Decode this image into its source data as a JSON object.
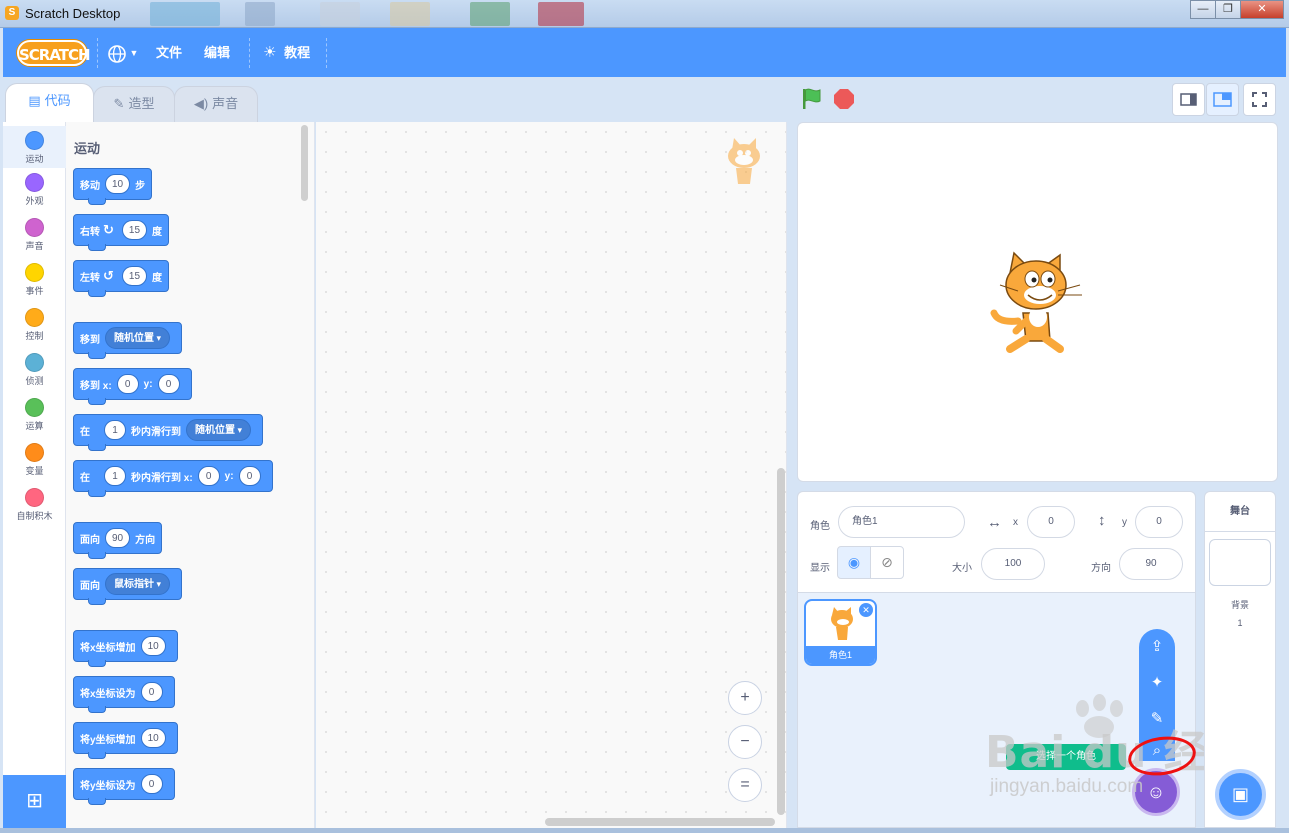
{
  "window": {
    "title": "Scratch Desktop",
    "controls": [
      "—",
      "❐",
      "✕"
    ]
  },
  "menubar": {
    "logo": "SCRATCH",
    "language_icon": "globe-icon",
    "file": "文件",
    "edit": "编辑",
    "tutorials": "教程"
  },
  "tabs": {
    "code": "代码",
    "costumes": "造型",
    "sounds": "声音"
  },
  "categories": [
    {
      "label": "运动",
      "color": "#4c97ff"
    },
    {
      "label": "外观",
      "color": "#9966ff"
    },
    {
      "label": "声音",
      "color": "#cf63cf"
    },
    {
      "label": "事件",
      "color": "#ffd500"
    },
    {
      "label": "控制",
      "color": "#ffab19"
    },
    {
      "label": "侦测",
      "color": "#5cb1d6"
    },
    {
      "label": "运算",
      "color": "#59c059"
    },
    {
      "label": "变量",
      "color": "#ff8c1a"
    },
    {
      "label": "自制积木",
      "color": "#ff6680"
    }
  ],
  "palette": {
    "heading": "运动",
    "blocks": {
      "move": {
        "a": "移动",
        "n": "10",
        "b": "步"
      },
      "turn_right": {
        "a": "右转",
        "n": "15",
        "b": "度"
      },
      "turn_left": {
        "a": "左转",
        "n": "15",
        "b": "度"
      },
      "goto": {
        "a": "移到",
        "menu": "随机位置"
      },
      "goto_xy": {
        "a": "移到 x:",
        "x": "0",
        "b": "y:",
        "y": "0"
      },
      "glide_to": {
        "a": "在",
        "n": "1",
        "b": "秒内滑行到",
        "menu": "随机位置"
      },
      "glide_xy": {
        "a": "在",
        "n": "1",
        "b": "秒内滑行到 x:",
        "x": "0",
        "c": "y:",
        "y": "0"
      },
      "point_dir": {
        "a": "面向",
        "n": "90",
        "b": "方向"
      },
      "point_towards": {
        "a": "面向",
        "menu": "鼠标指针"
      },
      "change_x": {
        "a": "将x坐标增加",
        "n": "10"
      },
      "set_x": {
        "a": "将x坐标设为",
        "n": "0"
      },
      "change_y": {
        "a": "将y坐标增加",
        "n": "10"
      },
      "set_y": {
        "a": "将y坐标设为",
        "n": "0"
      }
    }
  },
  "zoom": {
    "in": "+",
    "out": "−",
    "reset": "="
  },
  "sprite_info": {
    "sprite_label": "角色",
    "sprite_name": "角色1",
    "x_label": "x",
    "x": "0",
    "y_label": "y",
    "y": "0",
    "show_label": "显示",
    "size_label": "大小",
    "size": "100",
    "direction_label": "方向",
    "direction": "90"
  },
  "sprites": [
    {
      "name": "角色1"
    }
  ],
  "stage_pane": {
    "title": "舞台",
    "backdrops_label": "背景",
    "backdrops_count": "1"
  },
  "tooltip": "选择一个角色",
  "watermark": {
    "main": "Bai du 经验",
    "sub": "jingyan.baidu.com"
  },
  "colors": {
    "accent": "#4c97ff",
    "menubar": "#4c97ff",
    "flag": "#4cbf56",
    "stop": "#ec5959"
  }
}
